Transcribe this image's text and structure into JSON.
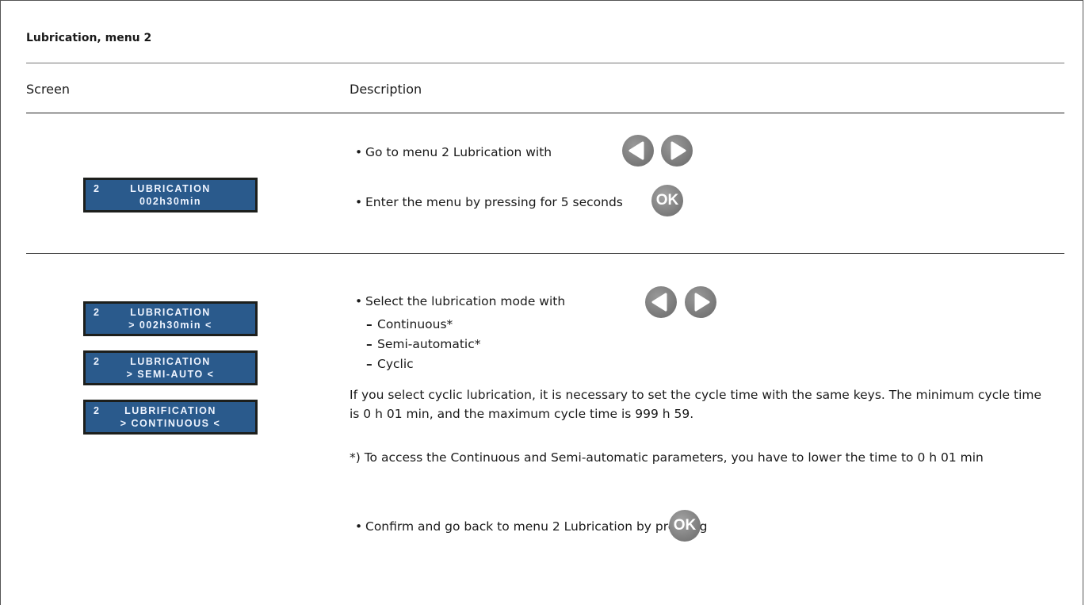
{
  "title": "Lubrication, menu 2",
  "columns": {
    "screen": "Screen",
    "description": "Description"
  },
  "row1": {
    "lcd": {
      "num": "2",
      "line1": "LUBRICATION",
      "line2": "002h30min"
    },
    "step1": "Go to menu 2 Lubrication with",
    "step2": "Enter the menu by pressing for 5 seconds",
    "ok_label": "OK"
  },
  "row2": {
    "lcds": [
      {
        "num": "2",
        "line1": "LUBRICATION",
        "line2": "> 002h30min <"
      },
      {
        "num": "2",
        "line1": "LUBRICATION",
        "line2": "> SEMI-AUTO <"
      },
      {
        "num": "2",
        "line1": "LUBRIFICATION",
        "line2": "> CONTINUOUS <"
      }
    ],
    "select": "Select the lubrication mode with",
    "modes": [
      "Continuous*",
      "Semi-automatic*",
      "Cyclic"
    ],
    "cyclic_note": "If you select cyclic lubrication, it is necessary to set the cycle time with the same keys. The minimum cycle time is 0 h 01 min, and the maximum cycle time is 999 h 59.",
    "footnote": "*) To access the Continuous and Semi-automatic parameters, you have to lower the time to 0 h 01 min",
    "confirm": "Confirm and go back to menu 2 Lubrication by pressing",
    "ok_label": "OK"
  }
}
